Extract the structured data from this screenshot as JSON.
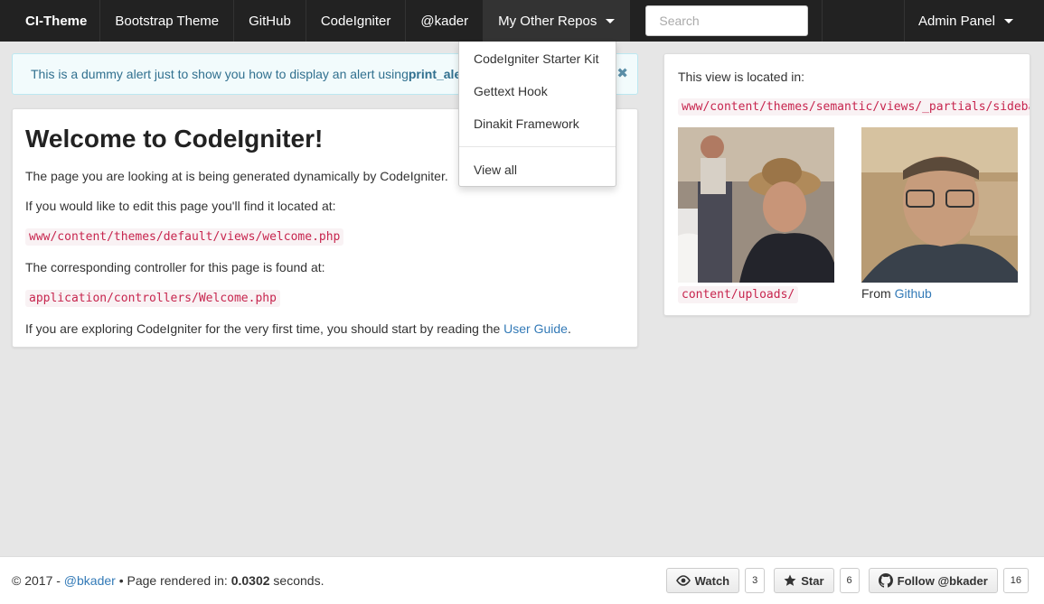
{
  "navbar": {
    "brand": "CI-Theme",
    "items": [
      {
        "label": "Bootstrap Theme"
      },
      {
        "label": "GitHub"
      },
      {
        "label": "CodeIgniter"
      },
      {
        "label": "@kader"
      },
      {
        "label": "My Other Repos"
      }
    ],
    "search_placeholder": "Search",
    "right_label": "Admin Panel"
  },
  "dropdown": {
    "items": [
      "CodeIgniter Starter Kit",
      "Gettext Hook",
      "Dinakit Framework"
    ],
    "view_all": "View all"
  },
  "alert": {
    "text": "This is a dummy alert just to show you how to display an alert using ",
    "bold": "print_alert()",
    "close": "✖"
  },
  "main": {
    "title": "Welcome to CodeIgniter!",
    "p1": "The page you are looking at is being generated dynamically by CodeIgniter.",
    "p2": "If you would like to edit this page you'll find it located at:",
    "code1": "www/content/themes/default/views/welcome.php",
    "p3": "The corresponding controller for this page is found at:",
    "code2": "application/controllers/Welcome.php",
    "p4_before": "If you are exploring CodeIgniter for the very first time, you should start by reading the ",
    "p4_link": "User Guide",
    "p4_after": "."
  },
  "sidebar": {
    "intro": "This view is located in:",
    "path": "www/content/themes/semantic/views/_partials/sidebar.php",
    "caption1": "content/uploads/",
    "caption2_prefix": "From ",
    "caption2_link": "Github"
  },
  "footer": {
    "copyright": "© 2017 - ",
    "author_link": "@bkader",
    "rendered_prefix": " • Page rendered in: ",
    "rendered_time": "0.0302",
    "rendered_suffix": " seconds.",
    "watch_label": "Watch",
    "watch_count": "3",
    "star_label": "Star",
    "star_count": "6",
    "follow_label": "Follow @bkader",
    "follow_count": "16"
  },
  "colors": {
    "navbar_bg": "#222222",
    "link": "#337ab7",
    "code": "#c7254e",
    "alert_text": "#31708f"
  }
}
